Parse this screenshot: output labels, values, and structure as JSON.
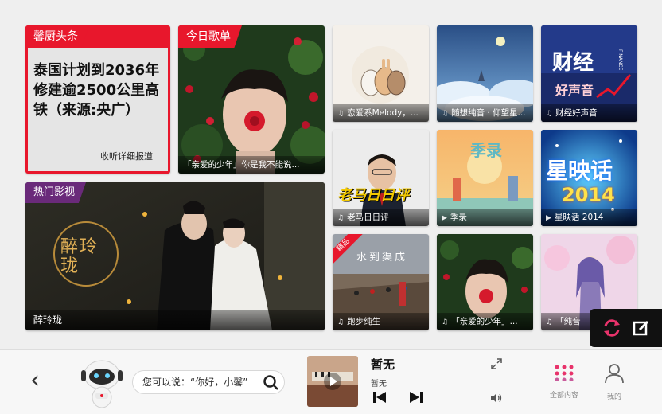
{
  "news": {
    "tag": "馨厨头条",
    "headline": "泰国计划到2036年 修建逾2500公里高铁（来源:央广）",
    "more": "收听详细报道"
  },
  "playlist": {
    "tag": "今日歌单",
    "caption": "「亲爱的少年」你是我不能说..."
  },
  "movie": {
    "tag": "热门影视",
    "caption": "醉玲珑",
    "poster_text": "醉玲珑"
  },
  "tiles": [
    {
      "caption": "恋爱系Melody，...",
      "icon": "music-icon"
    },
    {
      "caption": "随想纯音 · 仰望星...",
      "icon": "music-icon"
    },
    {
      "caption": "财经好声音",
      "icon": "music-icon",
      "art_title": "财经",
      "art_sub": "好声音",
      "art_en": "FINANCE"
    },
    {
      "caption": "老马日日评",
      "icon": "music-icon",
      "art_title": "老马日日评"
    },
    {
      "caption": "季录",
      "icon": "video-icon",
      "art_title": "季录"
    },
    {
      "caption": "星映话 2014",
      "icon": "video-icon",
      "art_title": "星映话",
      "art_sub": "2014"
    },
    {
      "caption": "跑步纯生",
      "icon": "music-icon",
      "badge": "精品",
      "art_title": "水到渠成"
    },
    {
      "caption": "「亲爱的少年」...",
      "icon": "music-icon"
    },
    {
      "caption": "「纯音",
      "icon": "music-icon"
    }
  ],
  "bottom": {
    "search_hint": "您可以说：“你好，小馨”",
    "now_playing_title": "暂无",
    "now_playing_sub": "暂无",
    "all_content": "全部内容",
    "mine": "我的"
  },
  "colors": {
    "accent": "#e8172c",
    "purple": "#6a2a7a",
    "pink": "#e8336b"
  }
}
